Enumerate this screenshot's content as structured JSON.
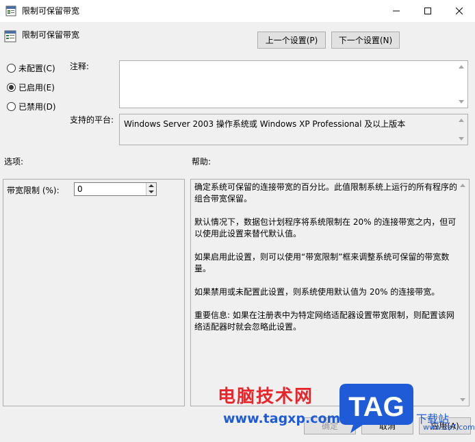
{
  "window": {
    "title": "限制可保留带宽",
    "minimize_icon": "minimize-icon",
    "maximize_icon": "maximize-icon",
    "close_icon": "close-icon"
  },
  "header": {
    "title": "限制可保留带宽",
    "prev_label": "上一个设置(P)",
    "next_label": "下一个设置(N)"
  },
  "state": {
    "options": [
      {
        "label": "未配置(C)",
        "selected": false
      },
      {
        "label": "已启用(E)",
        "selected": true
      },
      {
        "label": "已禁用(D)",
        "selected": false
      }
    ]
  },
  "comment": {
    "label": "注释:",
    "value": ""
  },
  "platform": {
    "label": "支持的平台:",
    "value": "Windows Server 2003 操作系统或 Windows XP Professional 及以上版本"
  },
  "options_section": {
    "label": "选项:",
    "bandwidth_label": "带宽限制 (%):",
    "bandwidth_value": "0"
  },
  "help_section": {
    "label": "帮助:",
    "paragraphs": [
      "确定系统可保留的连接带宽的百分比。此值限制系统上运行的所有程序的组合带宽保留。",
      "默认情况下，数据包计划程序将系统限制在 20% 的连接带宽之内，但可以使用此设置来替代默认值。",
      "如果启用此设置，则可以使用“带宽限制”框来调整系统可保留的带宽数量。",
      "如果禁用或未配置此设置，则系统使用默认值为 20% 的连接带宽。",
      "重要信息: 如果在注册表中为特定网络适配器设置带宽限制，则配置该网络适配器时就会忽略此设置。"
    ]
  },
  "footer": {
    "ok_label": "确定",
    "cancel_label": "取消",
    "apply_label": "应用(A)"
  },
  "watermark": {
    "site_name": "电脑技术网",
    "site_url": "www.tagxp.com",
    "logo_text": "TAG",
    "right_text": "下载站",
    "right_url": "www.xz7.com",
    "colors": {
      "red": "#e8252b",
      "blue": "#1f5bd7"
    }
  }
}
